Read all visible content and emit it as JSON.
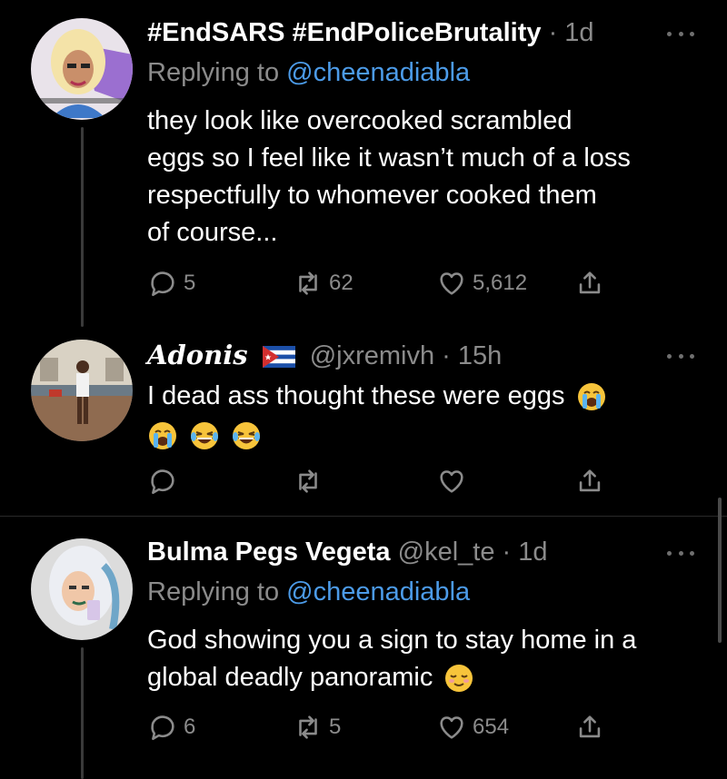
{
  "tweets": [
    {
      "name": "#EndSARS #EndPoliceBrutality",
      "time": "1d",
      "replying_prefix": "Replying to",
      "replying_to": "@cheenadiabla",
      "text_lines": [
        "they look like overcooked scrambled",
        "eggs so I feel like it wasn’t much of a loss",
        "respectfully to whomever cooked them",
        "of course..."
      ],
      "replies": "5",
      "retweets": "62",
      "likes": "5,612"
    },
    {
      "name": "Adonis",
      "handle": "@jxremivh",
      "time": "15h",
      "text_lines": [
        "I dead ass thought these were eggs"
      ],
      "emojis_line2": [
        "crying-face",
        "laughing-face",
        "laughing-face"
      ],
      "replies": "",
      "retweets": "",
      "likes": ""
    },
    {
      "name": "Bulma Pegs Vegeta",
      "handle": "@kel_te",
      "time": "1d",
      "replying_prefix": "Replying to",
      "replying_to": "@cheenadiabla",
      "text_lines": [
        "God showing you a sign to stay home in a",
        "global deadly panoramic"
      ],
      "replies": "6",
      "retweets": "5",
      "likes": "654"
    }
  ],
  "separator": "·",
  "colors": {
    "background": "#000000",
    "text": "#ffffff",
    "muted": "#8b8b8b",
    "link": "#4c9be8"
  }
}
